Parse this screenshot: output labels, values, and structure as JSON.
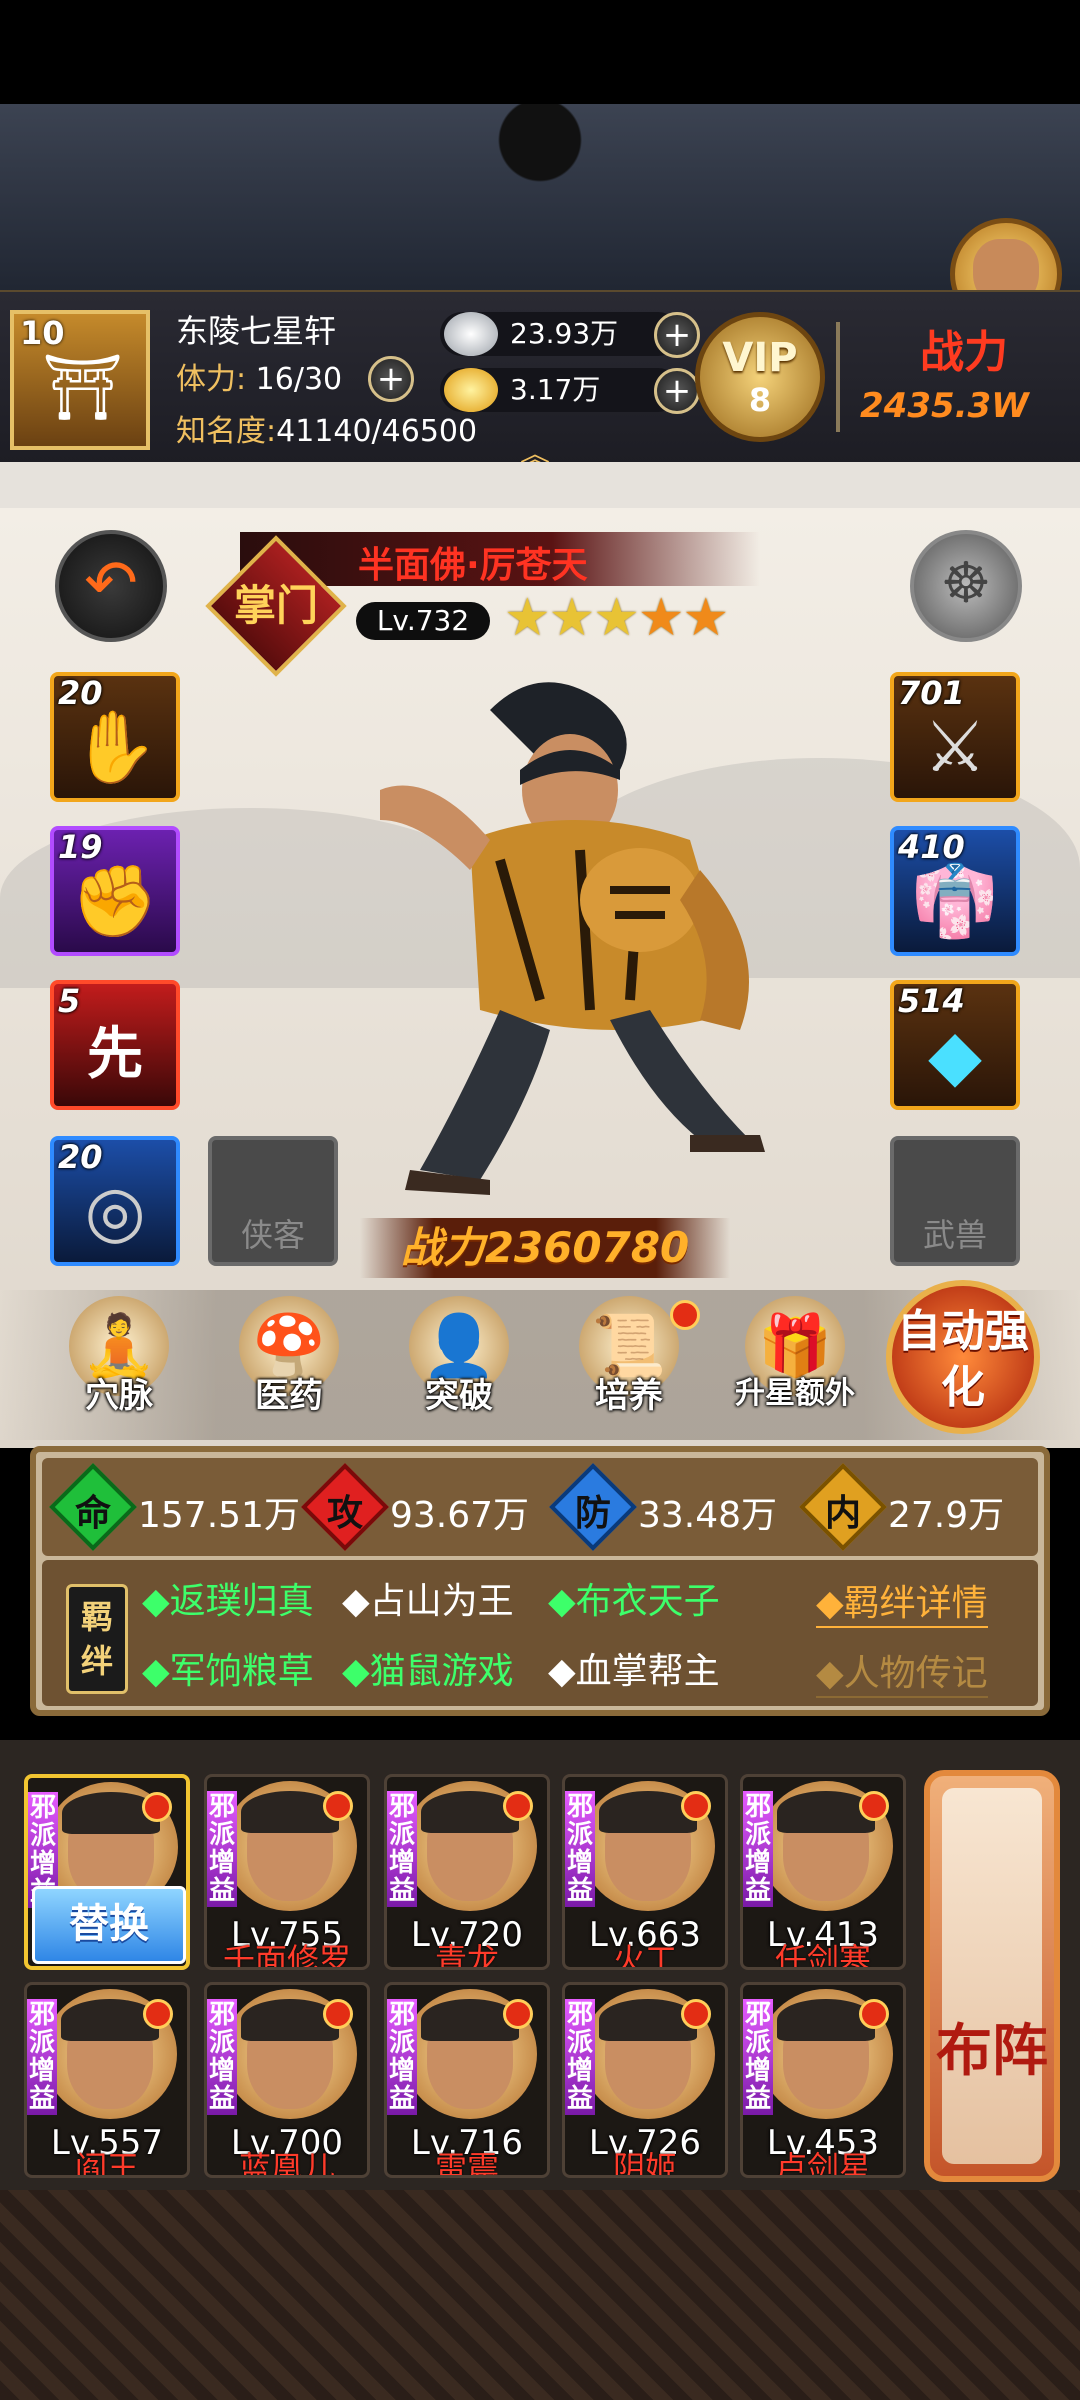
{
  "hud": {
    "player_level": "10",
    "guild_name": "东陵七星轩",
    "stamina_label": "体力:",
    "stamina_value": "16/30",
    "fame_label": "知名度:",
    "fame_value": "41140/46500",
    "silver": "23.93万",
    "gold": "3.17万",
    "vip_label": "VIP",
    "vip_level": "8",
    "power_label": "战力",
    "power_value": "2435.3W"
  },
  "hero": {
    "emblem": "掌门",
    "name": "半面佛·厉苍天",
    "level": "Lv.732",
    "stars": 5,
    "fight_power": "战力2360780"
  },
  "left_slots": [
    {
      "level": "20",
      "icon": "palm-icon"
    },
    {
      "level": "19",
      "icon": "purple-fist-icon"
    },
    {
      "level": "5",
      "icon": "first-strike-icon",
      "glyph": "先"
    },
    {
      "level": "20",
      "icon": "compass-icon"
    }
  ],
  "right_slots": [
    {
      "level": "701",
      "icon": "bracer-icon"
    },
    {
      "level": "410",
      "icon": "robe-icon"
    },
    {
      "level": "514",
      "icon": "gems-icon"
    }
  ],
  "empty_slots": {
    "companion": "侠客",
    "beast": "武兽"
  },
  "menu": [
    {
      "label": "穴脉",
      "icon": "meridian-icon"
    },
    {
      "label": "医药",
      "icon": "medicine-icon"
    },
    {
      "label": "突破",
      "icon": "breakthrough-icon"
    },
    {
      "label": "培养",
      "icon": "scroll-icon"
    },
    {
      "label": "升星额外",
      "icon": "star-upgrade-icon"
    }
  ],
  "auto_button": "自动强化",
  "stats": [
    {
      "gem": "命",
      "value": "157.51万",
      "color": "#1fbf3a"
    },
    {
      "gem": "攻",
      "value": "93.67万",
      "color": "#e02020"
    },
    {
      "gem": "防",
      "value": "33.48万",
      "color": "#2a7be0"
    },
    {
      "gem": "内",
      "value": "27.9万",
      "color": "#e0a020"
    }
  ],
  "bond": {
    "seal": "羁绊",
    "row1": [
      {
        "text": "◆返璞归真",
        "active": true
      },
      {
        "text": "◆占山为王",
        "active": false
      },
      {
        "text": "◆布衣天子",
        "active": true
      }
    ],
    "row2": [
      {
        "text": "◆军饷粮草",
        "active": true
      },
      {
        "text": "◆猫鼠游戏",
        "active": true
      },
      {
        "text": "◆血掌帮主",
        "active": false
      }
    ],
    "detail_link": "◆羁绊详情",
    "bio_link": "◆人物传记"
  },
  "roster": {
    "tag": "邪派增益",
    "swap": "替换",
    "formation": "布阵",
    "cards": [
      {
        "level": "",
        "name": "",
        "selected": true
      },
      {
        "level": "Lv.755",
        "name": "千面修罗"
      },
      {
        "level": "Lv.720",
        "name": "青龙"
      },
      {
        "level": "Lv.663",
        "name": "火工"
      },
      {
        "level": "Lv.413",
        "name": "任剑寒"
      },
      {
        "level": "Lv.557",
        "name": "阎王"
      },
      {
        "level": "Lv.700",
        "name": "蓝凰儿"
      },
      {
        "level": "Lv.716",
        "name": "雷震"
      },
      {
        "level": "Lv.726",
        "name": "阴姬"
      },
      {
        "level": "Lv.453",
        "name": "卢剑星"
      }
    ]
  }
}
